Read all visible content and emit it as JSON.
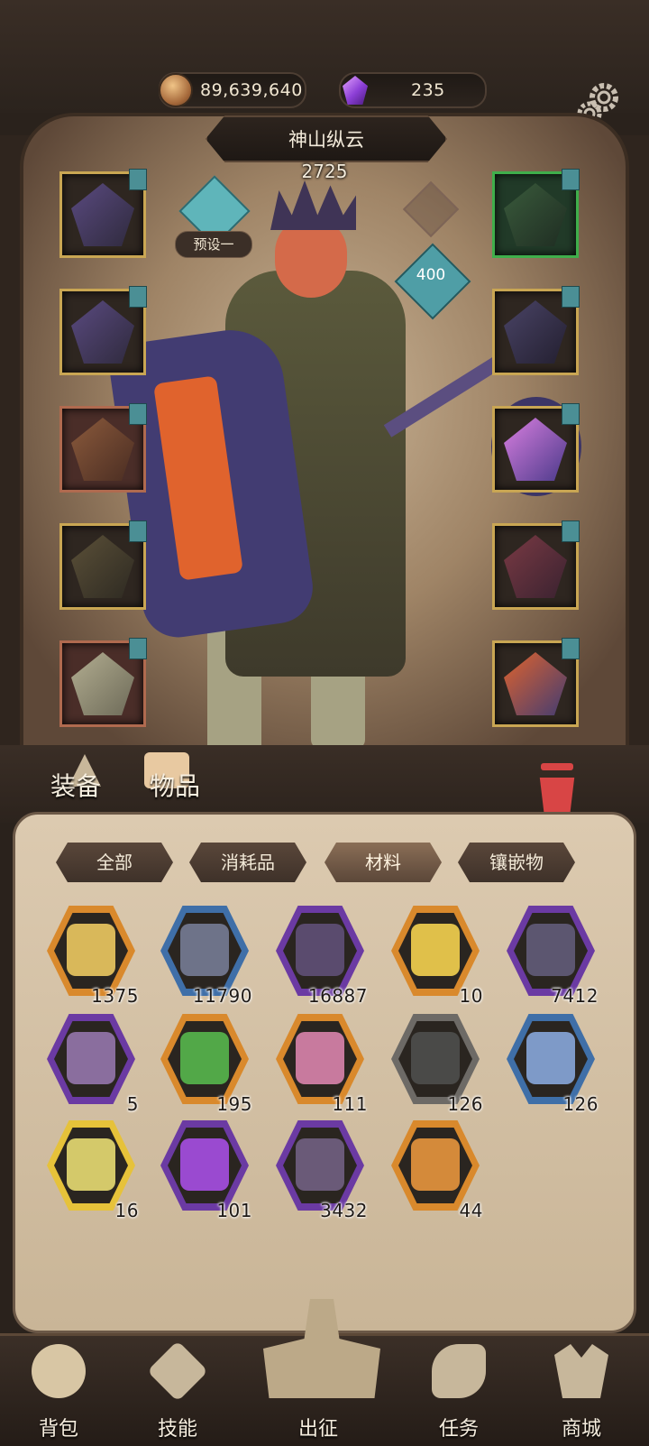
{
  "resources": {
    "gold": "89,639,640",
    "gems": "235",
    "gold_icon": "coin-icon",
    "gem_icon": "purple-crystal-icon"
  },
  "hero": {
    "name": "神山纵云",
    "power": "2725",
    "preset_label": "预设一",
    "level_badge": "400"
  },
  "equipment_slots_left": [
    "helmet",
    "armor",
    "gloves",
    "belt",
    "boots"
  ],
  "equipment_slots_right": [
    "necklace",
    "bracelet",
    "ring",
    "weapon",
    "offhand"
  ],
  "tabs": {
    "equip": "装备",
    "items": "物品"
  },
  "filters": [
    "全部",
    "消耗品",
    "材料",
    "镶嵌物"
  ],
  "active_filter": "材料",
  "items": [
    {
      "qty": "1375",
      "rarity": "orange"
    },
    {
      "qty": "11790",
      "rarity": "blue"
    },
    {
      "qty": "16887",
      "rarity": "purple"
    },
    {
      "qty": "10",
      "rarity": "orange"
    },
    {
      "qty": "7412",
      "rarity": "purple"
    },
    {
      "qty": "5",
      "rarity": "purple"
    },
    {
      "qty": "195",
      "rarity": "orange"
    },
    {
      "qty": "111",
      "rarity": "orange"
    },
    {
      "qty": "126",
      "rarity": "gray"
    },
    {
      "qty": "126",
      "rarity": "blue"
    },
    {
      "qty": "16",
      "rarity": "gold"
    },
    {
      "qty": "101",
      "rarity": "purple"
    },
    {
      "qty": "3432",
      "rarity": "purple"
    },
    {
      "qty": "44",
      "rarity": "orange"
    }
  ],
  "nav": [
    "背包",
    "技能",
    "出征",
    "任务",
    "商城"
  ],
  "colors": {
    "orange": "#d9892c",
    "blue": "#3f6fa8",
    "purple": "#6b3aa3",
    "gray": "#6d6a66",
    "gold": "#e6c23a"
  }
}
